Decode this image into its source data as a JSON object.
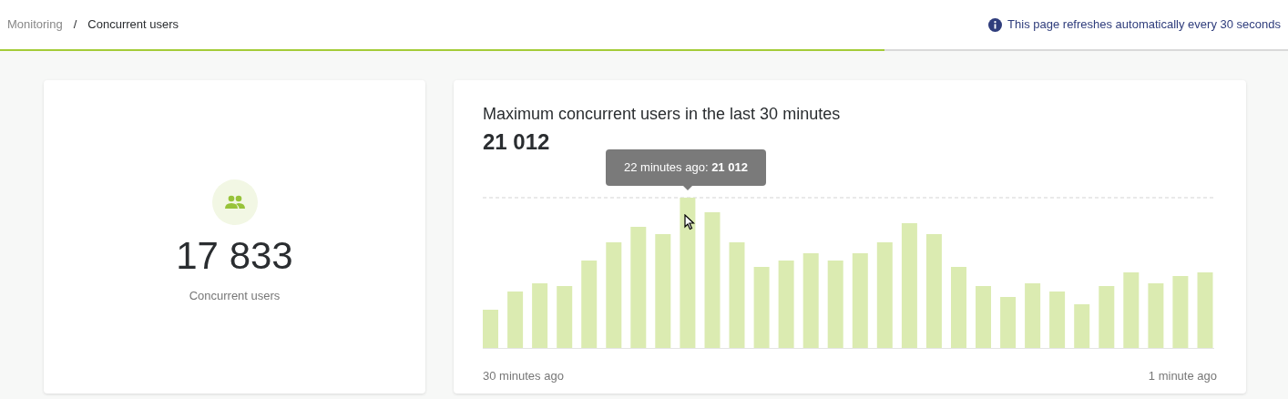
{
  "breadcrumb": [
    {
      "label": "Monitoring",
      "current": false
    },
    {
      "label": "Concurrent users",
      "current": true
    }
  ],
  "breadcrumb_separator": "/",
  "refresh_notice": "This page refreshes automatically every 30 seconds",
  "refresh_progress": {
    "level": 0.687
  },
  "current_card": {
    "value": "17 833",
    "label": "Concurrent users"
  },
  "max_card": {
    "title": "Maximum concurrent users in the last 30 minutes",
    "value": "21 012",
    "tooltip": "22 minutes ago: **21 012**",
    "x_start_label": "30 minutes ago",
    "x_end_label": "1 minute ago"
  }
}
